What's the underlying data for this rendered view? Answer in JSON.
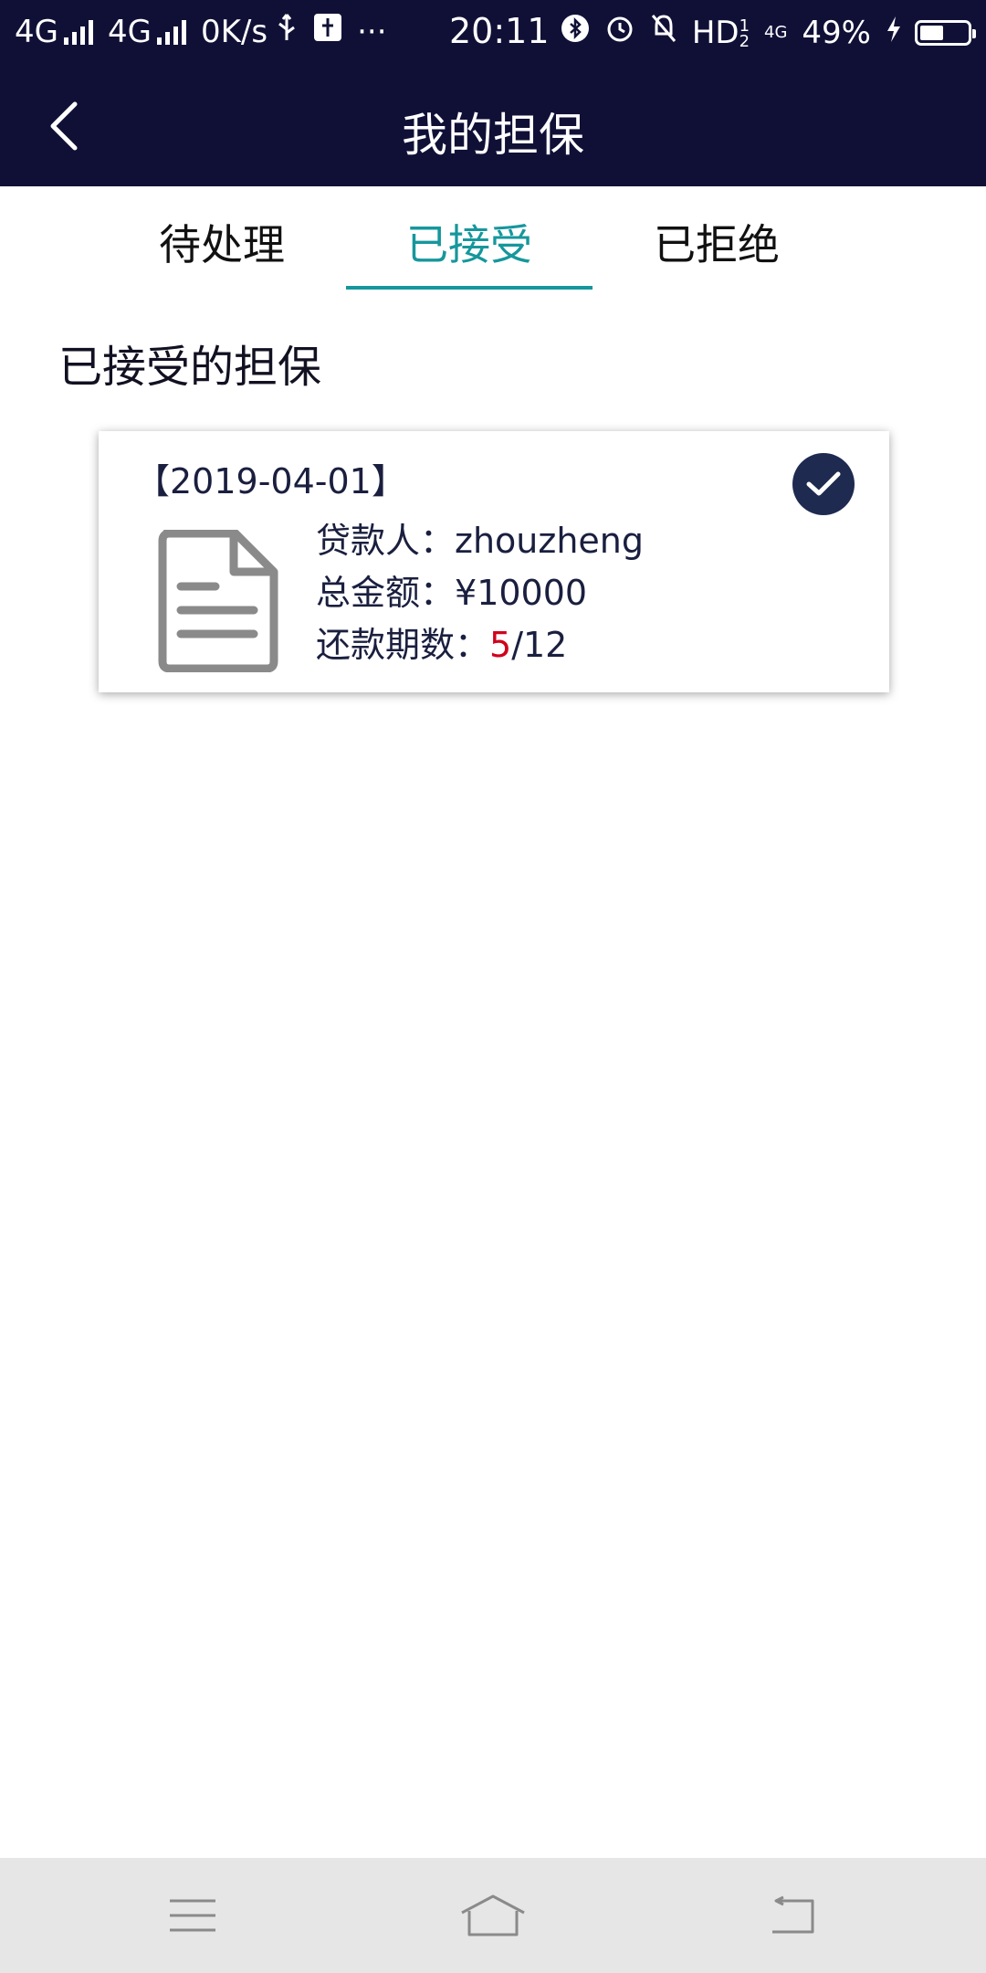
{
  "status_bar": {
    "network_1": "4G",
    "network_2": "4G",
    "speed": "0K/s",
    "more": "···",
    "time": "20:11",
    "hd": "HD",
    "hd_sup": "1",
    "hd_sub": "2",
    "network_right": "4G",
    "battery": "49%",
    "battery_level": 0.49
  },
  "header": {
    "title": "我的担保"
  },
  "tabs": [
    {
      "label": "待处理"
    },
    {
      "label": "已接受"
    },
    {
      "label": "已拒绝"
    }
  ],
  "active_tab": 1,
  "section_title": "已接受的担保",
  "card": {
    "date": "【2019-04-01】",
    "borrower_label": "贷款人：",
    "borrower": "zhouzheng",
    "amount_label": "总金额：",
    "amount": "¥10000",
    "periods_label": "还款期数：",
    "periods_paid": "5",
    "periods_total": "/12"
  },
  "colors": {
    "header_bg": "#101037",
    "accent": "#16979c",
    "check_bg": "#1e2a50",
    "highlight_red": "#d0021b",
    "nav_bg": "#e6e6e6"
  },
  "icons": {
    "back": "chevron-left-icon",
    "check": "check-circle-icon",
    "document": "document-icon",
    "menu": "menu-icon",
    "home": "home-icon",
    "back_nav": "return-icon"
  }
}
